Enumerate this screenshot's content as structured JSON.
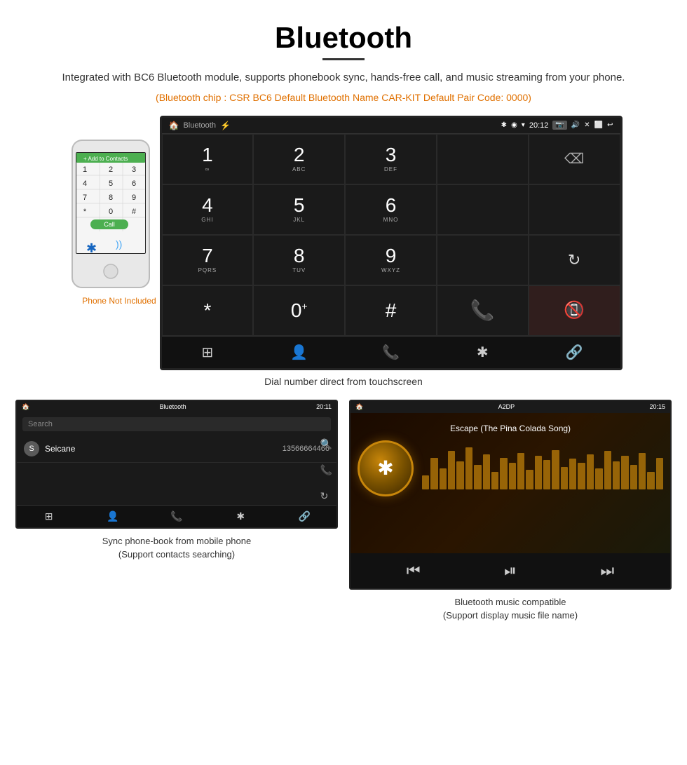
{
  "header": {
    "title": "Bluetooth",
    "subtitle": "Integrated with BC6 Bluetooth module, supports phonebook sync, hands-free call, and music streaming from your phone.",
    "specs": "(Bluetooth chip : CSR BC6    Default Bluetooth Name CAR-KIT    Default Pair Code: 0000)"
  },
  "main_screen": {
    "status_bar": {
      "left": "🏠",
      "center": "Bluetooth",
      "usb_icon": "⚡",
      "right_icons": "✱ ◉ ▾ 20:12",
      "far_right": "📷 🔊 ✕ ⬜ ↩"
    },
    "dialpad_rows": [
      [
        {
          "num": "1",
          "sub": "∞"
        },
        {
          "num": "2",
          "sub": "ABC"
        },
        {
          "num": "3",
          "sub": "DEF"
        },
        {
          "num": "",
          "sub": ""
        },
        {
          "num": "⌫",
          "sub": ""
        }
      ],
      [
        {
          "num": "4",
          "sub": "GHI"
        },
        {
          "num": "5",
          "sub": "JKL"
        },
        {
          "num": "6",
          "sub": "MNO"
        },
        {
          "num": "",
          "sub": ""
        },
        {
          "num": "",
          "sub": ""
        }
      ],
      [
        {
          "num": "7",
          "sub": "PQRS"
        },
        {
          "num": "8",
          "sub": "TUV"
        },
        {
          "num": "9",
          "sub": "WXYZ"
        },
        {
          "num": "",
          "sub": ""
        },
        {
          "num": "↻",
          "sub": ""
        }
      ],
      [
        {
          "num": "*",
          "sub": ""
        },
        {
          "num": "0",
          "sub": "+"
        },
        {
          "num": "#",
          "sub": ""
        },
        {
          "num": "📞",
          "sub": ""
        },
        {
          "num": "📵",
          "sub": ""
        }
      ]
    ],
    "bottom_icons": [
      "⊞",
      "👤",
      "📞",
      "✱",
      "🔗"
    ]
  },
  "dial_label": "Dial number direct from touchscreen",
  "phone_not_included": "Phone Not Included",
  "bottom_left_screen": {
    "status_bar_center": "Bluetooth",
    "status_bar_time": "20:11",
    "search_placeholder": "Search",
    "contacts": [
      {
        "initial": "S",
        "name": "Seicane",
        "number": "13566664466"
      }
    ],
    "caption_line1": "Sync phone-book from mobile phone",
    "caption_line2": "(Support contacts searching)"
  },
  "bottom_right_screen": {
    "status_bar_center": "A2DP",
    "status_bar_time": "20:15",
    "song_title": "Escape (The Pina Colada Song)",
    "caption_line1": "Bluetooth music compatible",
    "caption_line2": "(Support display music file name)"
  },
  "visualizer_bars": [
    20,
    45,
    30,
    55,
    40,
    60,
    35,
    50,
    25,
    45,
    38,
    52,
    28,
    48,
    42,
    56,
    32,
    44,
    38,
    50,
    30,
    55,
    40,
    48,
    35,
    52,
    25,
    45
  ]
}
